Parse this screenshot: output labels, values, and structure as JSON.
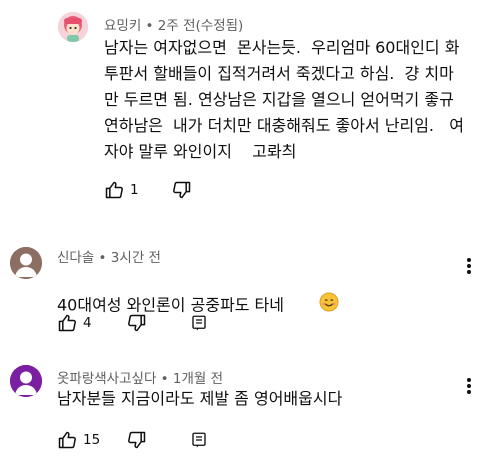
{
  "comments": [
    {
      "author": "요밍키",
      "time": " • 2주 전(수정됨)",
      "avatar_color": "#f4c3cf",
      "lines": [
        "남자는 여자없으면  몬사는듯.  우리엄마 60대인디 화",
        "투판서 할배들이 집적거려서 죽겠다고 하심.  걍 치마",
        "만 두르면 됨. 연상남은 지갑을 열으니 얻어먹기 좋규",
        "연하남은  내가 더치만 대충해줘도 좋아서 난리임.   여",
        "자야 말루 와인이지    고롸츼"
      ],
      "likes": "1",
      "like_label": "like",
      "dislike_label": "dislike"
    },
    {
      "author": "신다솔",
      "time": " • 3시간 전",
      "avatar_color": "#8d6e63",
      "lines": [
        "40대여성 와인론이 공중파도 타네"
      ],
      "emoji": "smiling-face-emoji",
      "likes": "4"
    },
    {
      "author": "옷파랑색사고싶다",
      "time": " • 1개월 전",
      "avatar_color": "#7b1fa2",
      "lines": [
        "남자분들 지금이라도 제발 좀 영어배웁시다"
      ],
      "likes": "15"
    }
  ],
  "icons": {
    "like": "thumb-up-icon",
    "dislike": "thumb-down-icon",
    "reply": "reply-comment-icon",
    "menu": "more-vertical-icon"
  }
}
